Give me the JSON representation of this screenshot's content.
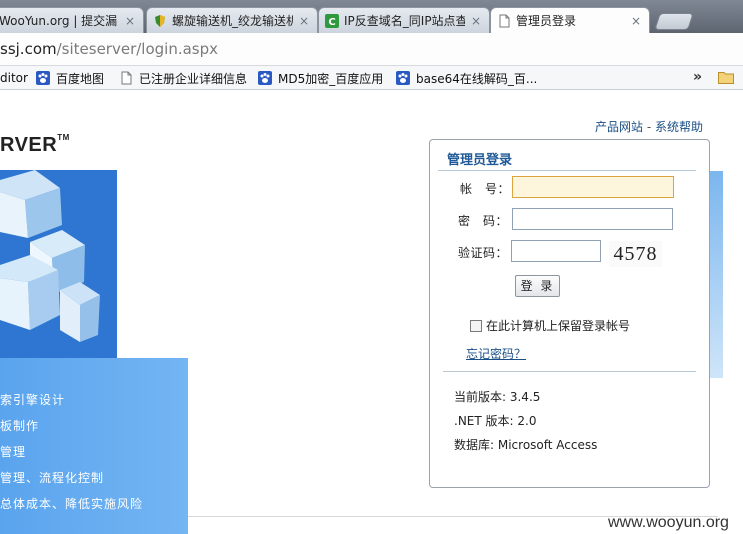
{
  "browser": {
    "tabs": [
      {
        "title": "WooYun.org | 提交漏",
        "active": false
      },
      {
        "title": "螺旋输送机_绞龙输送机",
        "active": false
      },
      {
        "title": "IP反查域名_同IP站点查",
        "active": false
      },
      {
        "title": "管理员登录",
        "active": true
      }
    ],
    "close_glyph": "×",
    "url_host": "ssj.com",
    "url_path": "/siteserver/login.aspx",
    "bookmarks": [
      "ditor",
      "百度地图",
      "已注册企业详细信息",
      "MD5加密_百度应用",
      "base64在线解码_百..."
    ],
    "bookmarks_more": "»"
  },
  "page": {
    "top_links": {
      "product": "产品网站",
      "separator": " - ",
      "help": "系统帮助"
    },
    "logo_text": "RVER",
    "logo_tm": "TM",
    "features": [
      "索引擎设计",
      "板制作",
      "管理",
      "管理、流程化控制",
      "总体成本、降低实施风险"
    ],
    "watermark": "www.wooyun.org"
  },
  "login": {
    "title": "管理员登录",
    "account_label": "帐　号：",
    "password_label": "密　码：",
    "code_label": "验证码：",
    "account_value": "",
    "password_value": "",
    "code_value": "",
    "captcha": "4578",
    "button": "登 录",
    "remember": "在此计算机上保留登录帐号",
    "forgot": "忘记密码？",
    "version": "当前版本: 3.4.5",
    "dotnet": ".NET 版本: 2.0",
    "database": "数据库: Microsoft Access"
  },
  "colors": {
    "accent": "#1f5a96",
    "banner": "#2e76d1",
    "feature_panel": "#6aaef1"
  }
}
